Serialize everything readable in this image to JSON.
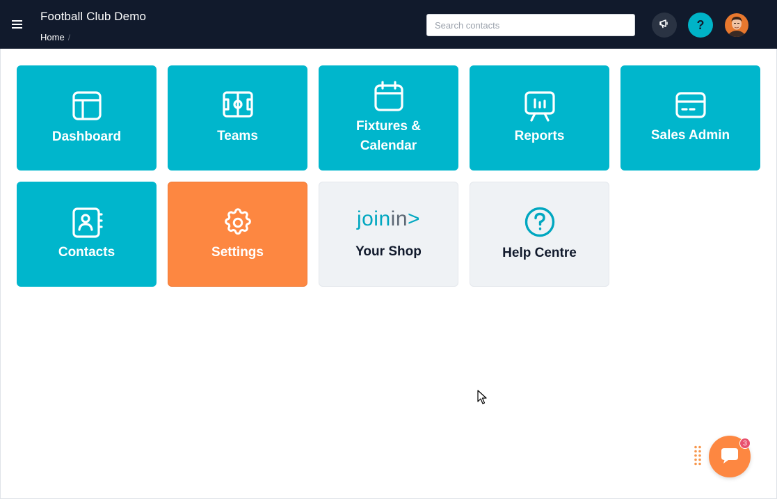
{
  "header": {
    "app_title": "Football Club Demo",
    "breadcrumb": {
      "items": [
        "Home"
      ],
      "separator": "/"
    },
    "search": {
      "placeholder": "Search contacts",
      "value": ""
    },
    "help_label": "?"
  },
  "tiles": [
    {
      "label": "Dashboard",
      "icon": "layout-icon",
      "color": "#00b6cc"
    },
    {
      "label": "Teams",
      "icon": "pitch-icon",
      "color": "#00b6cc"
    },
    {
      "label_line1": "Fixtures &",
      "label_line2": "Calendar",
      "icon": "calendar-icon",
      "color": "#00b6cc"
    },
    {
      "label": "Reports",
      "icon": "presentation-icon",
      "color": "#00b6cc"
    },
    {
      "label": "Sales Admin",
      "icon": "credit-card-icon",
      "color": "#00b6cc"
    },
    {
      "label": "Contacts",
      "icon": "address-book-icon",
      "color": "#00b6cc"
    },
    {
      "label": "Settings",
      "icon": "gear-icon",
      "color": "#fd8741"
    },
    {
      "label": "Your Shop",
      "logo": {
        "part1": "join",
        "part2": "in",
        "part3": ">"
      },
      "color": "#eff2f5"
    },
    {
      "label": "Help Centre",
      "icon": "question-circle-icon",
      "color": "#eff2f5"
    }
  ],
  "chat": {
    "badge_count": "3"
  },
  "colors": {
    "topbar": "#111a2c",
    "teal": "#00b6cc",
    "orange": "#fd8741",
    "light": "#eff2f5"
  }
}
